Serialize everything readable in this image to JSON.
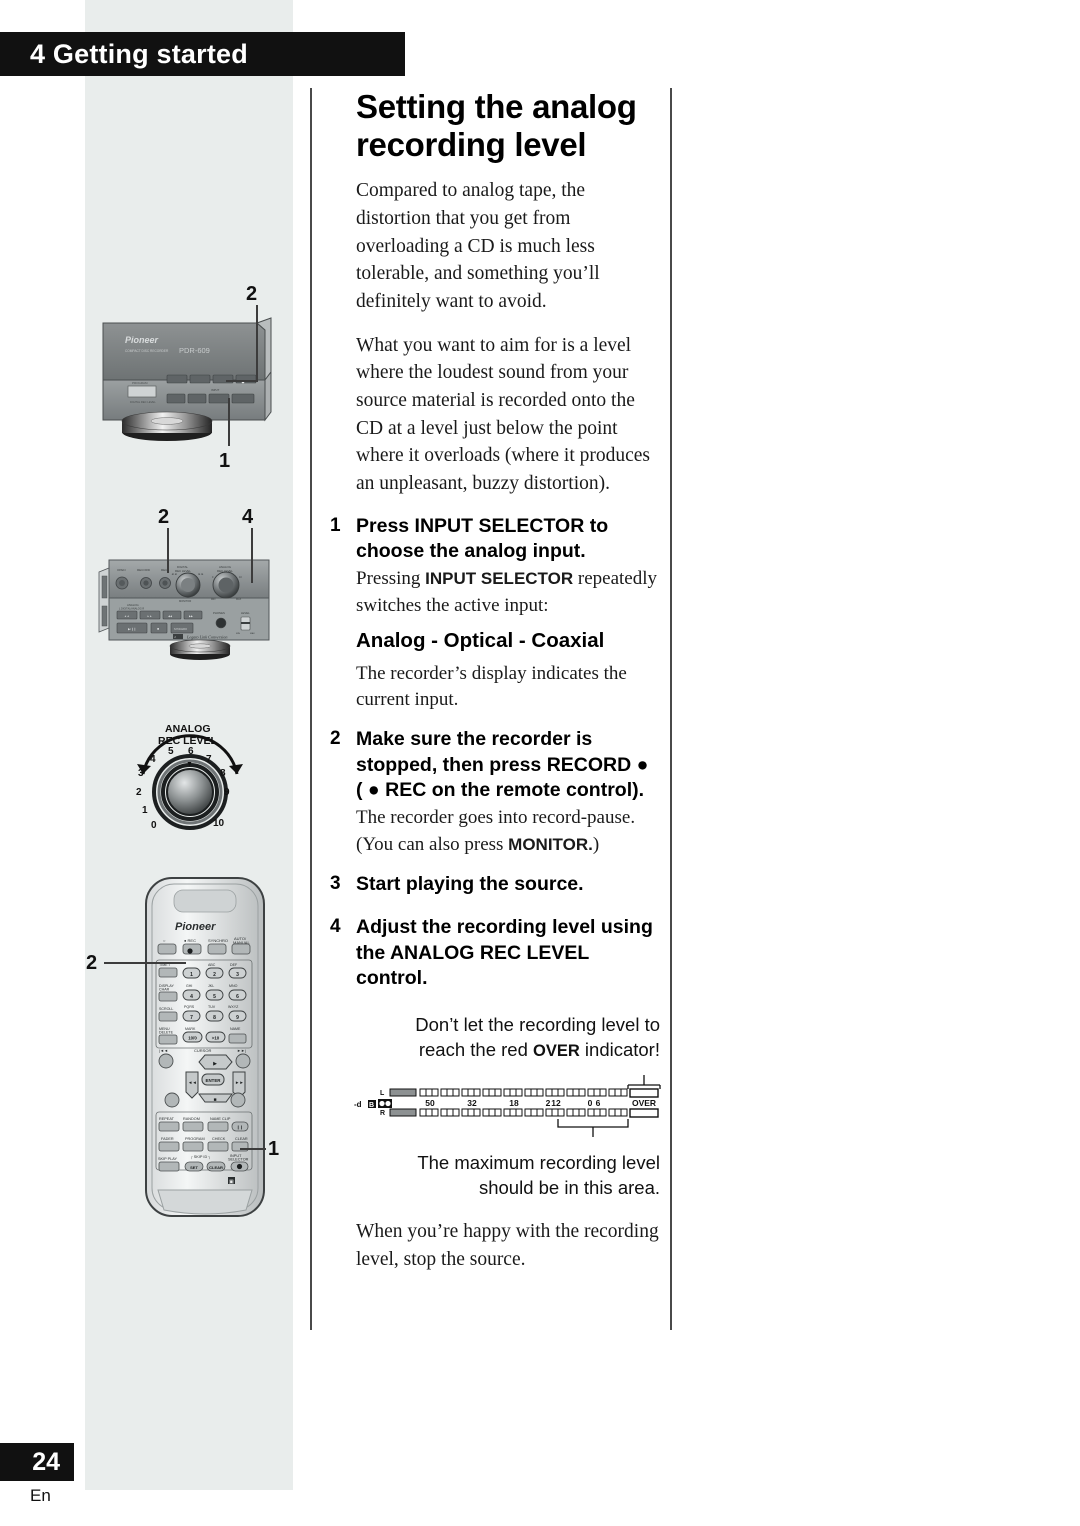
{
  "page": {
    "chapter_banner": "4 Getting started",
    "page_number": "24",
    "language_code": "En"
  },
  "article": {
    "title_line1": "Setting the analog",
    "title_line2": "recording level",
    "intro_paragraph_1": "Compared to analog tape, the distortion that you get from overloading a CD is much less tolerable, and something you’ll definitely want to avoid.",
    "intro_paragraph_2": "What you want to aim for is a level where the loudest sound from your source material is recorded onto the CD at a level just below the point where it overloads (where it produces an unpleasant, buzzy distortion).",
    "closing_paragraph": "When you’re happy with the recording level, stop the source."
  },
  "steps": [
    {
      "number": "1",
      "heading": "Press INPUT SELECTOR to choose the analog input.",
      "sub_before": "Pressing ",
      "sub_bold": "INPUT SELECTOR",
      "sub_after": " repeatedly switches the active input:",
      "modes": "Analog - Optical -  Coaxial",
      "sub2": "The recorder’s display indicates the current input."
    },
    {
      "number": "2",
      "heading_line1": "Make sure the recorder is",
      "heading_line2": "stopped, then press RECORD ●",
      "heading_line3": "( ● REC on the remote control).",
      "sub_before": "The recorder goes into record-pause. (You can also press ",
      "sub_bold": "MONITOR.",
      "sub_after": ")"
    },
    {
      "number": "3",
      "heading": "Start playing the source."
    },
    {
      "number": "4",
      "heading": "Adjust the recording level using the ANALOG REC LEVEL control.",
      "note_before": "Don’t let the recording level to reach the red ",
      "note_bold": "OVER",
      "note_after": " indicator!",
      "note2": "The maximum recording level should be in this area."
    }
  ],
  "level_meter": {
    "unit_label": "-dB",
    "channel_left": "L",
    "channel_right": "R",
    "scale_marks": [
      "50",
      "32",
      "18",
      "12",
      "6",
      "2",
      "0"
    ],
    "over_label": "OVER"
  },
  "illustrations": {
    "recorder_front": {
      "brand": "Pioneer",
      "model": "PDR-609",
      "model_sub": "COMPACT DISC RECORDER",
      "callouts": [
        "2",
        "1"
      ]
    },
    "front_panel_detail": {
      "labels": [
        "OPEN",
        "RECORD",
        "REC",
        "DIGITAL REC LEVEL",
        "ANALOG REC LEVEL",
        "ANALOG L DIGITAL/ANALOG R",
        "PHONES",
        "LEVEL",
        "Legato Link Conversion"
      ],
      "callouts": [
        "2",
        "4"
      ]
    },
    "rec_level_knob": {
      "label_line1": "ANALOG",
      "label_line2": "REC LEVEL",
      "scale": [
        "0",
        "1",
        "2",
        "3",
        "4",
        "5",
        "6",
        "7",
        "8",
        "9",
        "10"
      ]
    },
    "remote": {
      "brand": "Pioneer",
      "top_row": [
        "○",
        "● REC",
        "SYNCHRO",
        "AUTO/MANUAL"
      ],
      "left_column": [
        "TIME  I",
        "DISPLAY CHAR",
        "SCROLL",
        "MENU DELETE"
      ],
      "keypad": [
        {
          "key": "1",
          "letters": ""
        },
        {
          "key": "2",
          "letters": "ABC"
        },
        {
          "key": "3",
          "letters": "DEF"
        },
        {
          "key": "4",
          "letters": "GHI"
        },
        {
          "key": "5",
          "letters": "JKL"
        },
        {
          "key": "6",
          "letters": "MNO"
        },
        {
          "key": "7",
          "letters": "PQRS"
        },
        {
          "key": "8",
          "letters": "TUV"
        },
        {
          "key": "9",
          "letters": "WXYZ"
        },
        {
          "key": "10/0",
          "letters": "MARK"
        },
        {
          "key": ">10",
          "letters": ""
        },
        {
          "key": "",
          "letters": "NAME"
        }
      ],
      "cursor_label": "CURSOR",
      "enter_label": "ENTER",
      "function_rows": [
        "REPEAT",
        "RANDOM",
        "NAME CLIP",
        "FADER",
        "PROGRAM",
        "CHECK",
        "CLEAR",
        "SKIP PLAY",
        "SKIP ID",
        "SET",
        "CLEAR",
        "INPUT SELECTOR"
      ],
      "callouts": [
        "2",
        "1"
      ]
    }
  }
}
